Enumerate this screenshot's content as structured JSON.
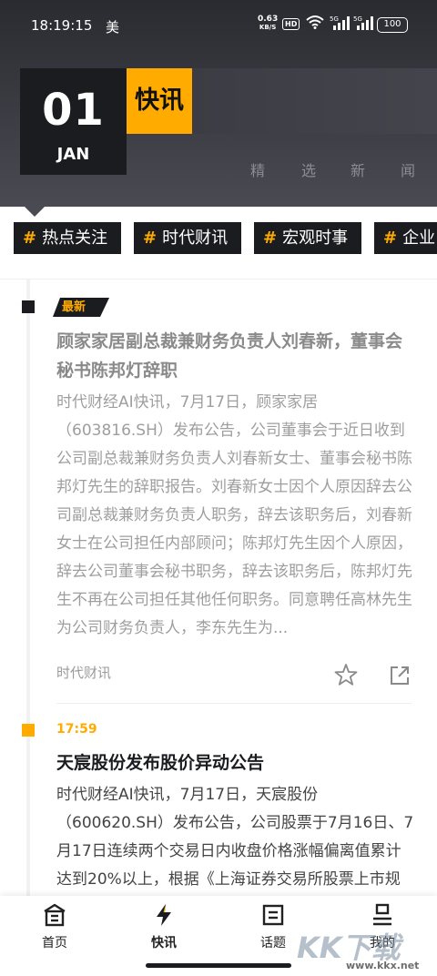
{
  "status_bar": {
    "time": "18:19:15",
    "carrier": "美",
    "net_speed_value": "0.63",
    "net_speed_unit": "KB/S",
    "hd": "HD",
    "battery": "100"
  },
  "header": {
    "day": "01",
    "month": "JAN",
    "brand": "快讯",
    "subtitle_chars": [
      "精",
      "选",
      "新",
      "闻"
    ]
  },
  "tags": [
    {
      "hash": "#",
      "label": "热点关注"
    },
    {
      "hash": "#",
      "label": "时代财讯"
    },
    {
      "hash": "#",
      "label": "宏观时事"
    },
    {
      "hash": "#",
      "label": "企业"
    }
  ],
  "articles": [
    {
      "badge": "最新",
      "title": "顾家家居副总裁兼财务负责人刘春新，董事会秘书陈邦灯辞职",
      "body": "时代财经AI快讯，7月17日，顾家家居（603816.SH）发布公告，公司董事会于近日收到公司副总裁兼财务负责人刘春新女士、董事会秘书陈邦灯先生的辞职报告。刘春新女士因个人原因辞去公司副总裁兼财务负责人职务，辞去该职务后，刘春新女士在公司担任内部顾问；陈邦灯先生因个人原因，辞去公司董事会秘书职务，辞去该职务后，陈邦灯先生不再在公司担任其他任何职务。同意聘任高林先生为公司财务负责人，李东先生为...",
      "source": "时代财讯"
    },
    {
      "time": "17:59",
      "title": "天宸股份发布股价异动公告",
      "body": "时代财经AI快讯，7月17日，天宸股份（600620.SH）发布公告，公司股票于7月16日、7月17日连续两个交易日内收盘价格涨幅偏离值累计达到20%以上，根据《上海证券交易所股票上市规则》有关规定，属于股票交易异常波动情形。"
    }
  ],
  "bottom_nav": [
    {
      "label": "首页",
      "icon": "home-icon"
    },
    {
      "label": "快讯",
      "icon": "lightning-icon"
    },
    {
      "label": "话题",
      "icon": "topic-icon"
    },
    {
      "label": "我的",
      "icon": "profile-icon"
    }
  ],
  "watermark": {
    "text": "KK下载",
    "url": "www.kkx.net"
  },
  "colors": {
    "accent": "#ffab00",
    "dark": "#1b1c20"
  }
}
